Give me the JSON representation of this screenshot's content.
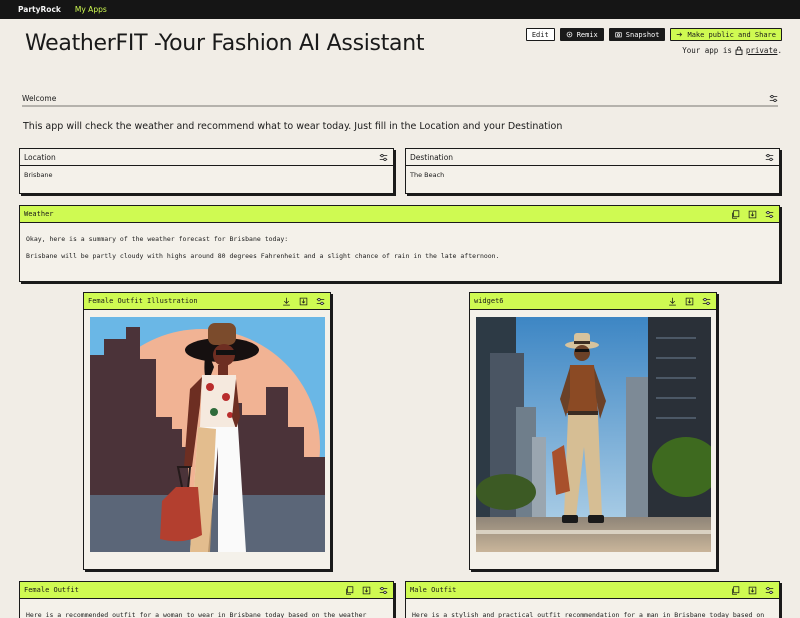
{
  "topbar": {
    "brand": "PartyRock",
    "my_apps": "My Apps"
  },
  "app": {
    "title": "WeatherFIT -Your Fashion AI Assistant"
  },
  "header_buttons": {
    "edit": "Edit",
    "remix": "Remix",
    "snapshot": "Snapshot",
    "share": "Make public and Share"
  },
  "privacy": {
    "prefix": "Your app is",
    "status": "private",
    "suffix": "."
  },
  "welcome": {
    "label": "Welcome",
    "intro": "This app will check the weather and recommend what to wear today. Just fill in the Location and your Destination"
  },
  "location": {
    "label": "Location",
    "value": "Brisbane"
  },
  "destination": {
    "label": "Destination",
    "value": "The Beach"
  },
  "weather": {
    "title": "Weather",
    "line1": "Okay, here is a summary of the weather forecast for Brisbane today:",
    "line2": "Brisbane will be partly cloudy with highs around 80 degrees Fahrenheit and a slight chance of rain in the late afternoon."
  },
  "female_illustration": {
    "title": "Female Outfit Illustration"
  },
  "widget6": {
    "title": "widget6"
  },
  "female_outfit": {
    "title": "Female Outfit",
    "text": "Here is a recommended outfit for a woman to wear in Brisbane today based on the weather"
  },
  "male_outfit": {
    "title": "Male Outfit",
    "text": "Here is a stylish and practical outfit recommendation for a man in Brisbane today based on"
  },
  "colors": {
    "accent": "#cffa52",
    "background": "#f1ede6",
    "topbar": "#151515"
  }
}
